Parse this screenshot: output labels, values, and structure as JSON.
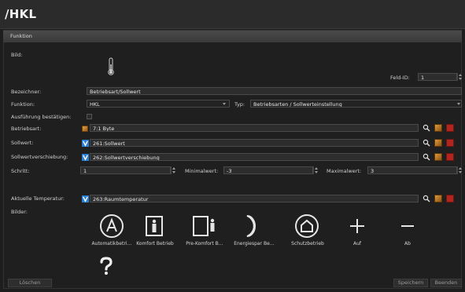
{
  "window": {
    "title": "/HKL"
  },
  "panel": {
    "title": "Funktion"
  },
  "labels": {
    "bild": "Bild:",
    "feld_id": "Feld-ID:",
    "bezeichner": "Bezeichner:",
    "funktion": "Funktion:",
    "typ": "Typ:",
    "ausfuehrung": "Ausführung bestätigen:",
    "betriebsart": "Betriebsart:",
    "sollwert": "Sollwert:",
    "sollwertverschiebung": "Sollwertverschiebung:",
    "schritt": "Schritt:",
    "minimalwert": "Minimalwert:",
    "maximalwert": "Maximalwert:",
    "aktuelle_temperatur": "Aktuelle Temperatur:",
    "bilder": "Bilder:"
  },
  "fields": {
    "feld_id": "1",
    "bezeichner": "Betriebsart/Sollwert",
    "funktion": "HKL",
    "typ": "Betriebsarten / Sollwerteinstellung",
    "betriebsart": "7:1 Byte",
    "sollwert": "261:Sollwert",
    "sollwertverschiebung": "262:Sollwertverschiebung",
    "schritt": "1",
    "minimalwert": "-3",
    "maximalwert": "3",
    "aktuelle_temperatur": "263:Raumtemperatur"
  },
  "images": [
    {
      "label": "Automatikbetri…",
      "icon": "automatic-mode-icon"
    },
    {
      "label": "Komfort Betrieb",
      "icon": "comfort-mode-icon"
    },
    {
      "label": "Pre-Komfort B…",
      "icon": "pre-comfort-mode-icon"
    },
    {
      "label": "Energiespar Be…",
      "icon": "energy-saving-mode-icon"
    },
    {
      "label": "Schutzbetrieb",
      "icon": "protection-mode-icon"
    },
    {
      "label": "Auf",
      "icon": "plus-icon"
    },
    {
      "label": "Ab",
      "icon": "minus-icon"
    }
  ],
  "buttons": {
    "loeschen": "Löschen",
    "speichern": "Speichern",
    "beenden": "Beenden"
  },
  "colors": {
    "accent_blue": "#2a7fd4",
    "delete_red": "#b0261e",
    "background": "#1e1e1e"
  }
}
